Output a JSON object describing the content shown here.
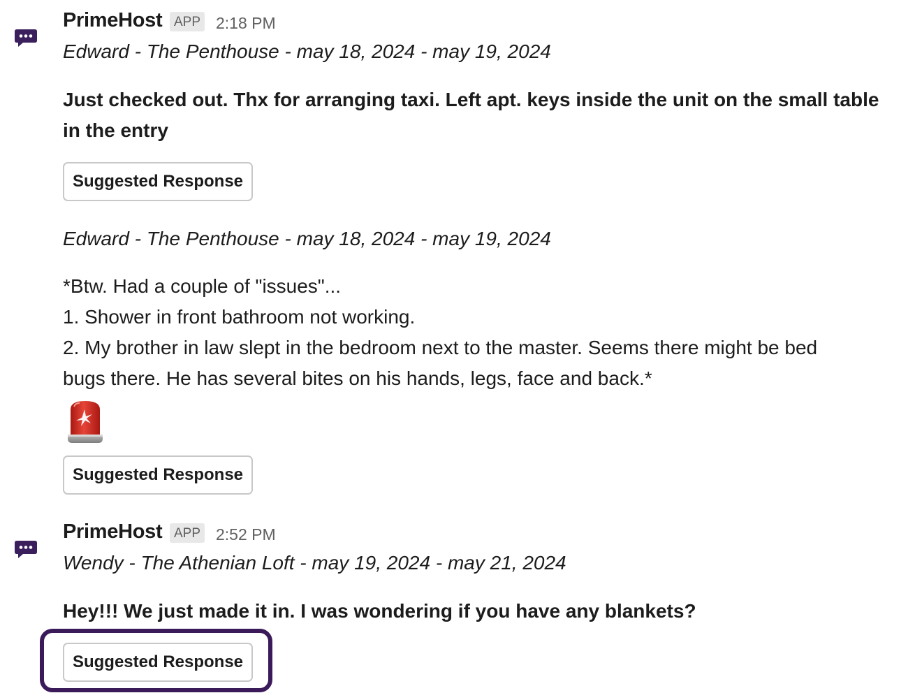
{
  "colors": {
    "highlight_border": "#3b1a5a",
    "badge_bg": "#e8e8e8",
    "muted_text": "#616061",
    "avatar_icon": "#3b1f5c",
    "alert_light": "#d9342b"
  },
  "messages": [
    {
      "sender": "PrimeHost",
      "badge": "APP",
      "time": "2:18 PM",
      "avatar_icon": "speech-bubble-ellipsis-icon",
      "booking": "Edward - The Penthouse - may 18, 2024 - may 19, 2024",
      "text": "Just checked out. Thx for arranging taxi. Left apt. keys inside the unit on the small table in the entry",
      "button": "Suggested Response"
    },
    {
      "booking": "Edward - The Penthouse - may 18, 2024 - may 19, 2024",
      "lines": [
        "*Btw. Had a couple of \"issues\"...",
        "1. Shower in front bathroom not working.",
        "2. My brother in law slept in the bedroom next to the master. Seems there might be bed",
        "bugs there. He has several bites on his hands, legs, face and back.*"
      ],
      "emoji": "rotating-light-icon",
      "button": "Suggested Response"
    },
    {
      "sender": "PrimeHost",
      "badge": "APP",
      "time": "2:52 PM",
      "avatar_icon": "speech-bubble-ellipsis-icon",
      "booking": "Wendy - The Athenian Loft - may 19, 2024 - may 21, 2024",
      "text": "Hey!!! We just made it in. I was wondering if you have any blankets?",
      "button": "Suggested Response"
    }
  ]
}
